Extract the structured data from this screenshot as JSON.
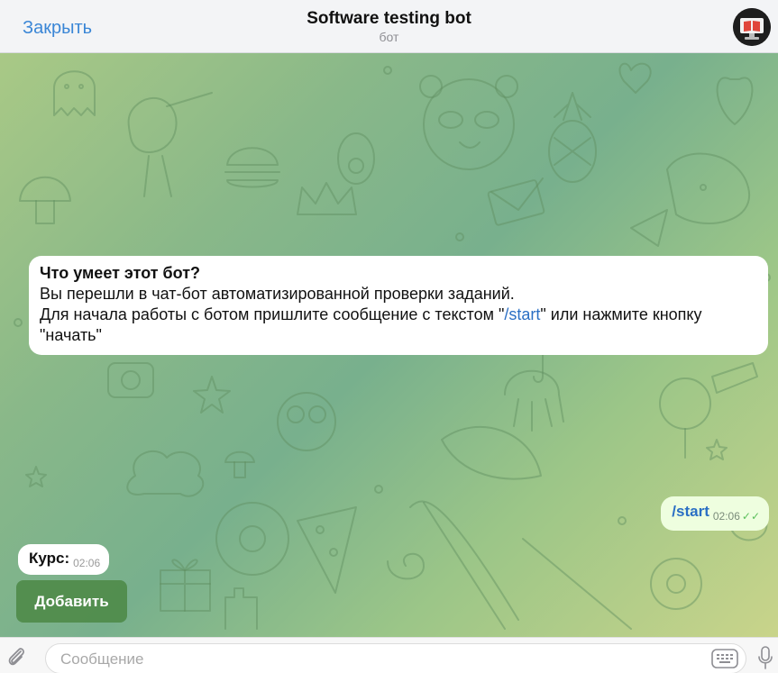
{
  "header": {
    "close_label": "Закрыть",
    "title": "Software testing bot",
    "subtitle": "бот"
  },
  "info_card": {
    "title": "Что умеет этот бот?",
    "line1": "Вы перешли в чат-бот автоматизированной проверки заданий.",
    "line2_before": "Для начала работы с ботом пришлите сообщение с текстом \"",
    "line2_command": "/start",
    "line2_after": "\" или нажмите кнопку \"начать\""
  },
  "messages": {
    "outgoing": {
      "text": "/start",
      "time": "02:06",
      "status": "read"
    },
    "incoming": {
      "text": "Курс:",
      "time": "02:06"
    }
  },
  "keyboard": {
    "button_label": "Добавить"
  },
  "composer": {
    "placeholder": "Сообщение"
  },
  "colors": {
    "accent": "#3a86d6",
    "link": "#2a6fc4",
    "outgoing_bubble": "#eefedf",
    "keyboard_button": "#4f8b4a"
  },
  "icons": {
    "attach": "paperclip-icon",
    "keyboard": "keyboard-icon",
    "mic": "microphone-icon",
    "read": "double-check-icon"
  }
}
